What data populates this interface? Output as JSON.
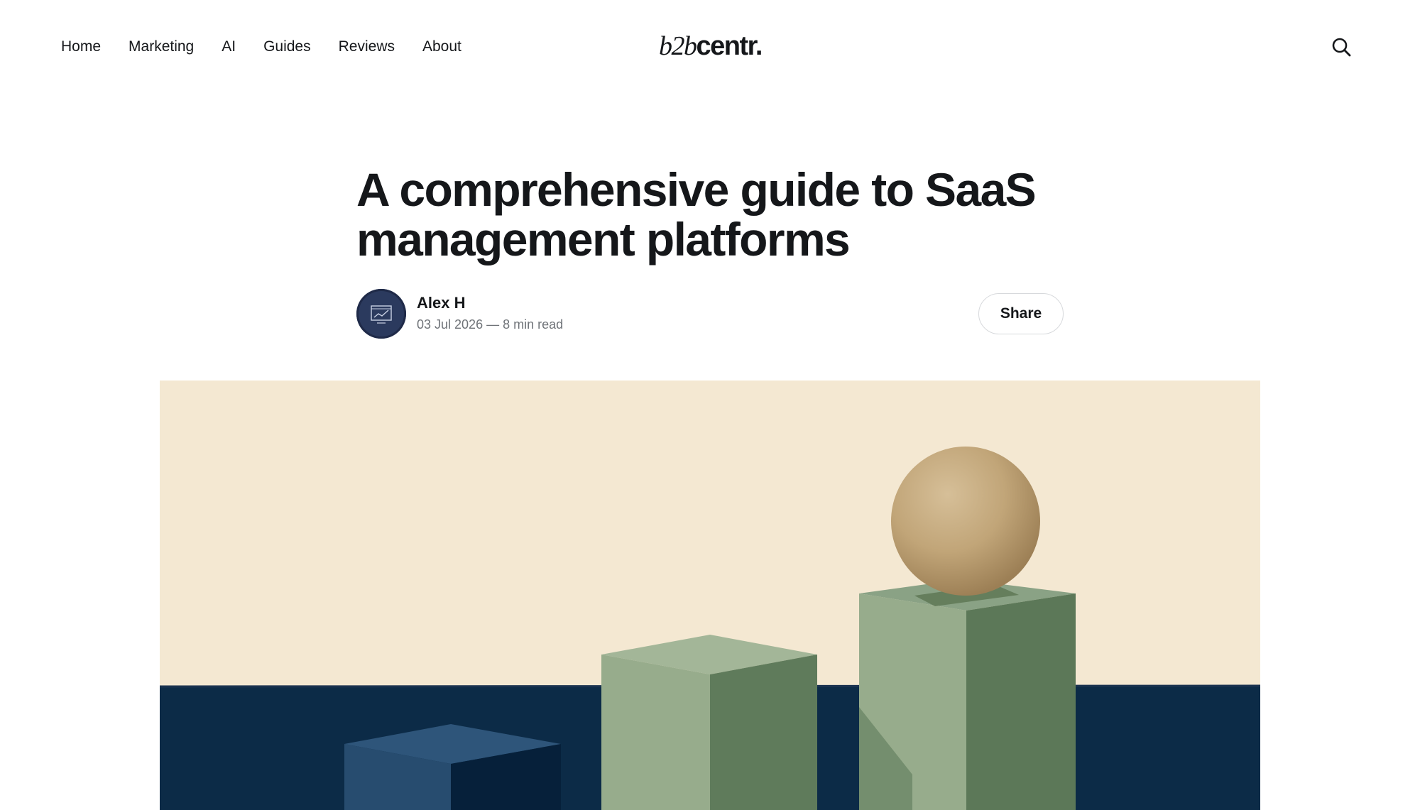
{
  "nav": {
    "links": [
      "Home",
      "Marketing",
      "AI",
      "Guides",
      "Reviews",
      "About"
    ]
  },
  "logo": {
    "italic": "b2b",
    "bold": "centr."
  },
  "article": {
    "title": "A comprehensive guide to SaaS management platforms",
    "author": "Alex H",
    "date": "03 Jul 2026",
    "read_time": "8 min read",
    "meta_separator": " — "
  },
  "share": {
    "label": "Share"
  },
  "colors": {
    "text": "#15171a",
    "muted": "#6f7378",
    "hero_sky": "#f4e8d2",
    "hero_sea": "#0c2b47",
    "green_light": "#97ac8c",
    "green_dark": "#5c7858",
    "sphere": "#c1a578",
    "blue_block": "#274c6f"
  }
}
